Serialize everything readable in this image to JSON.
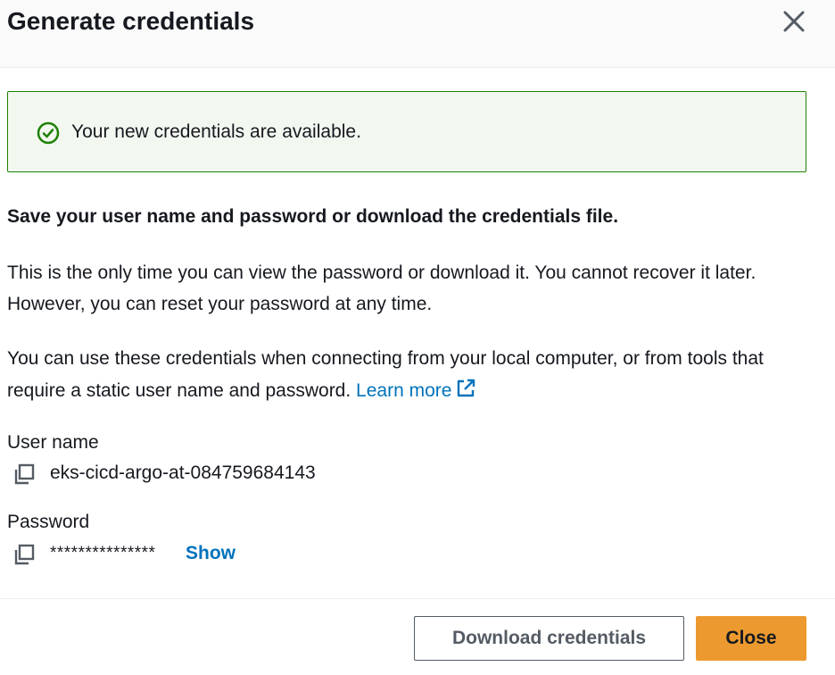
{
  "modal": {
    "title": "Generate credentials",
    "close_icon": "close-icon"
  },
  "alert": {
    "type": "success",
    "icon": "check-circle-icon",
    "message": "Your new credentials are available.",
    "border_color": "#1d8102",
    "background_color": "#f2f8f0"
  },
  "content": {
    "heading": "Save your user name and password or download the credentials file.",
    "paragraph1": "This is the only time you can view the password or download it. You cannot recover it later. However, you can reset your password at any time.",
    "paragraph2": "You can use these credentials when connecting from your local computer, or from tools that require a static user name and password.",
    "learn_more_label": "Learn more",
    "learn_more_icon": "external-link-icon",
    "link_color": "#0073bb"
  },
  "credentials": {
    "username_label": "User name",
    "username_value": "eks-cicd-argo-at-084759684143",
    "password_label": "Password",
    "password_masked": "***************",
    "show_label": "Show",
    "copy_icon": "copy-icon"
  },
  "footer": {
    "download_label": "Download credentials",
    "close_label": "Close",
    "primary_color": "#ec9a2f"
  }
}
